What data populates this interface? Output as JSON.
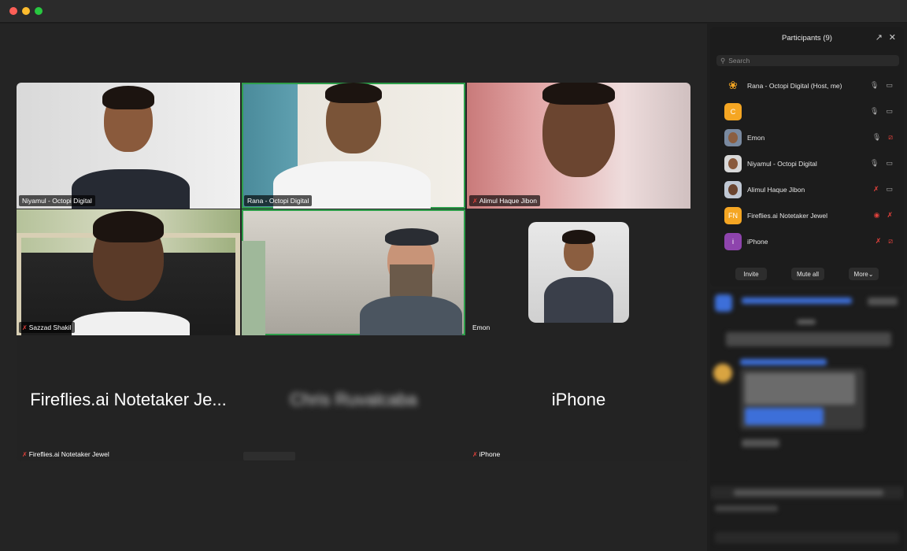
{
  "window": {
    "title": ""
  },
  "tiles": [
    {
      "name": "Niyamul - Octopi Digital",
      "muted": false
    },
    {
      "name": "Rana - Octopi Digital",
      "muted": false
    },
    {
      "name": "Alimul Haque Jibon",
      "muted": true
    },
    {
      "name": "Sazzad Shakil",
      "muted": true
    },
    {
      "name": "",
      "muted": false
    },
    {
      "name": "Emon",
      "muted": false
    },
    {
      "name": "Fireflies.ai Notetaker Jewel",
      "display": "Fireflies.ai Notetaker Je...",
      "muted": true
    },
    {
      "name": "",
      "display": "Chris Ruvalcaba",
      "muted": false
    },
    {
      "name": "iPhone",
      "display": "iPhone",
      "muted": true
    }
  ],
  "participants_panel": {
    "title": "Participants (9)",
    "search_placeholder": "Search",
    "items": [
      {
        "name": "Rana - Octopi Digital (Host, me)",
        "avatar": "",
        "mic": "on",
        "video": "on"
      },
      {
        "name": "",
        "avatar": "C",
        "mic": "on",
        "video": "on"
      },
      {
        "name": "Emon",
        "avatar": "",
        "mic": "on",
        "video": "off"
      },
      {
        "name": "Niyamul - Octopi Digital",
        "avatar": "",
        "mic": "on",
        "video": "on"
      },
      {
        "name": "Alimul Haque Jibon",
        "avatar": "",
        "mic": "off",
        "video": "on"
      },
      {
        "name": "Fireflies.ai Notetaker Jewel",
        "avatar": "FN",
        "mic": "rec",
        "video": "off"
      },
      {
        "name": "iPhone",
        "avatar": "i",
        "mic": "off",
        "video": "off"
      }
    ],
    "buttons": {
      "invite": "Invite",
      "mute_all": "Mute all",
      "more": "More"
    }
  },
  "colors": {
    "active_speaker": "#2e9e4a",
    "muted_red": "#e0413b",
    "avatar_c": "#f5a623",
    "avatar_fn": "#f5a623",
    "avatar_i": "#8e44ad"
  }
}
